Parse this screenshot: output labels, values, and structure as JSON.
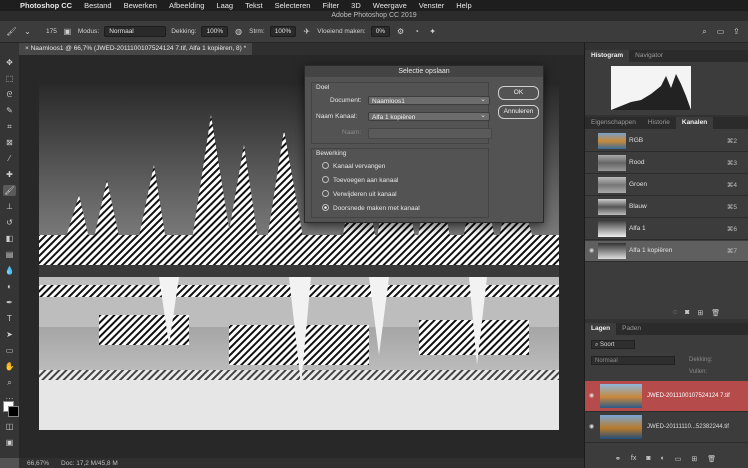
{
  "menubar": {
    "apple": "",
    "app": "Photoshop CC",
    "items": [
      "Bestand",
      "Bewerken",
      "Afbeelding",
      "Laag",
      "Tekst",
      "Selecteren",
      "Filter",
      "3D",
      "Weergave",
      "Venster",
      "Help"
    ]
  },
  "window_title": "Adobe Photoshop CC 2019",
  "options": {
    "brush_size": "175",
    "mode_label": "Modus:",
    "mode_value": "Normaal",
    "opacity_label": "Dekking:",
    "opacity_value": "100%",
    "flow_label": "Strm:",
    "flow_value": "100%",
    "smoothing_label": "Vloeiend maken:",
    "smoothing_value": "0%"
  },
  "doc_tab": "Naamloos1 @ 66,7% (JWED-2011100107524124 7.tif, Alfa 1 kopiëren, 8) *",
  "status": {
    "zoom": "66,67%",
    "doc": "Doc: 17,2 M/45,8 M"
  },
  "dialog": {
    "title": "Selectie opslaan",
    "doel_label": "Doel",
    "document_label": "Document:",
    "document_value": "Naamloos1",
    "channel_label": "Naam Kanaal:",
    "channel_value": "Alfa 1 kopiëren",
    "name_label": "Naam:",
    "bewerking_label": "Bewerking",
    "options": [
      "Kanaal vervangen",
      "Toevoegen aan kanaal",
      "Verwijderen uit kanaal",
      "Doorsnede maken met kanaal"
    ],
    "selected_option": 3,
    "ok": "OK",
    "cancel": "Annuleren"
  },
  "panels": {
    "top_tabs": [
      "Histogram",
      "Navigator"
    ],
    "mid_tabs": [
      "Eigenschappen",
      "Historie",
      "Kanalen"
    ],
    "channels": [
      {
        "name": "RGB",
        "shortcut": "⌘2"
      },
      {
        "name": "Rood",
        "shortcut": "⌘3"
      },
      {
        "name": "Groen",
        "shortcut": "⌘4"
      },
      {
        "name": "Blauw",
        "shortcut": "⌘5"
      },
      {
        "name": "Alfa 1",
        "shortcut": "⌘6"
      },
      {
        "name": "Alfa 1 kopiëren",
        "shortcut": "⌘7"
      }
    ],
    "layers_tabs": [
      "Lagen",
      "Paden"
    ],
    "filter_label": "Soort",
    "blend_mode": "Normaal",
    "opacity_label": "Dekking:",
    "fill_label": "Vullen:",
    "layers": [
      {
        "name": "JWED-2011100107524124 7.tif"
      },
      {
        "name": "JWED-20111110...52382244.tif"
      }
    ]
  },
  "colors": {
    "selected_layer": "#b64b4b",
    "panel_bg": "#3c3c3c"
  }
}
